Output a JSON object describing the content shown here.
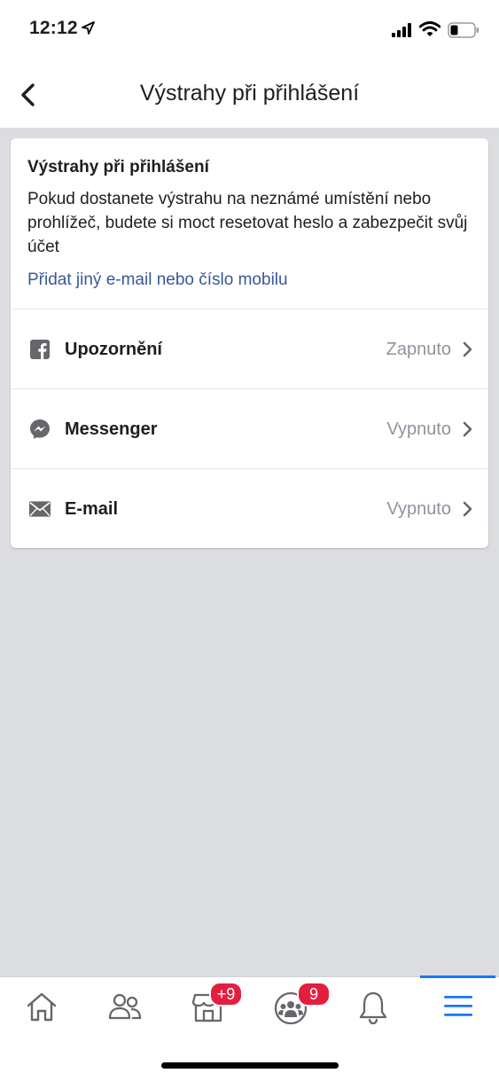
{
  "status_bar": {
    "time": "12:12"
  },
  "nav": {
    "title": "Výstrahy při přihlášení"
  },
  "card": {
    "title": "Výstrahy při přihlášení",
    "description": "Pokud dostanete výstrahu na neznámé umístění nebo prohlížeč, budete si moct resetovat heslo a zabezpečit svůj účet",
    "link": "Přidat jiný e-mail nebo číslo mobilu",
    "rows": [
      {
        "label": "Upozornění",
        "value": "Zapnuto",
        "icon": "facebook-icon"
      },
      {
        "label": "Messenger",
        "value": "Vypnuto",
        "icon": "messenger-icon"
      },
      {
        "label": "E-mail",
        "value": "Vypnuto",
        "icon": "envelope-icon"
      }
    ]
  },
  "tab_bar": {
    "tabs": [
      {
        "name": "home",
        "icon": "home-icon"
      },
      {
        "name": "friends",
        "icon": "friends-icon"
      },
      {
        "name": "marketplace",
        "icon": "marketplace-icon",
        "badge": "+9"
      },
      {
        "name": "groups",
        "icon": "groups-icon",
        "badge": "9"
      },
      {
        "name": "notifications",
        "icon": "bell-icon"
      },
      {
        "name": "menu",
        "icon": "menu-icon",
        "active": true
      }
    ]
  },
  "colors": {
    "link": "#385898",
    "accent": "#1877f2",
    "badge": "#e41e3f",
    "background": "#dcdde1"
  }
}
